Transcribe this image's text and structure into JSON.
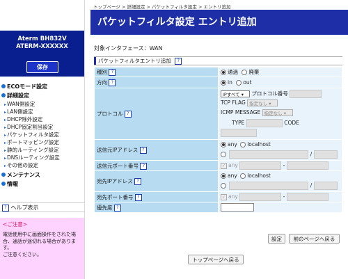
{
  "sidebar": {
    "model": "Aterm   BH832V",
    "device_name": "ATERM-XXXXXX",
    "save_label": "保存",
    "menu": {
      "eco": "ECOモード設定",
      "detail": "詳細設定",
      "detail_items": [
        "WAN側設定",
        "LAN側設定",
        "DHCP除外設定",
        "DHCP固定割当設定",
        "パケットフィルタ設定",
        "ポートマッピング設定",
        "静的ルーティング設定",
        "DNSルーティング設定",
        "その他の設定"
      ],
      "maintenance": "メンテナンス",
      "info": "情報"
    },
    "help_label": "ヘルプ表示",
    "notice": {
      "title": "<ご注意>",
      "body_1": "電話使用中に画面操作をされた場合、通話が途切れる場合があります。",
      "body_2": "ご注意ください。"
    }
  },
  "main": {
    "breadcrumb": "トップページ > 詳細設定 > パケットフィルタ設定 > エントリ追加",
    "title": "パケットフィルタ設定 エントリ追加",
    "interface_label": "対象インタフェース：WAN",
    "section_title": "パケットフィルタエントリ追加",
    "help_icon": "?",
    "rows": {
      "type": {
        "label": "種別",
        "opt_pass": "通過",
        "opt_discard": "廃棄"
      },
      "direction": {
        "label": "方向",
        "opt_in": "in",
        "opt_out": "out"
      },
      "protocol": {
        "label": "プロトコル",
        "select_value": "IPすべて",
        "proto_num_label": "プロトコル番号",
        "tcp_flag_label": "TCP FLAG",
        "tcp_flag_value": "指定なし",
        "icmp_label": "ICMP MESSAGE",
        "icmp_value": "指定なし",
        "type_label": "TYPE",
        "code_label": "CODE"
      },
      "src_ip": {
        "label": "送信元IPアドレス",
        "opt_any": "any",
        "opt_localhost": "localhost",
        "slash": "/"
      },
      "src_port": {
        "label": "送信元ポート番号",
        "any": "any",
        "dash": "-"
      },
      "dst_ip": {
        "label": "宛先IPアドレス",
        "opt_any": "any",
        "opt_localhost": "localhost",
        "slash": "/"
      },
      "dst_port": {
        "label": "宛先ポート番号",
        "any": "any",
        "dash": "-"
      },
      "priority": {
        "label": "優先度",
        "value": ""
      }
    },
    "buttons": {
      "set": "設定",
      "back_prev": "前のページへ戻る",
      "back_top": "トップページへ戻る"
    }
  },
  "colors": {
    "navy": "#0a1f8f",
    "title_blue": "#1d2ea6",
    "label_bg": "#b7dcf2",
    "value_bg": "#e9f3fb",
    "notice_bg": "#ffd3ff"
  }
}
